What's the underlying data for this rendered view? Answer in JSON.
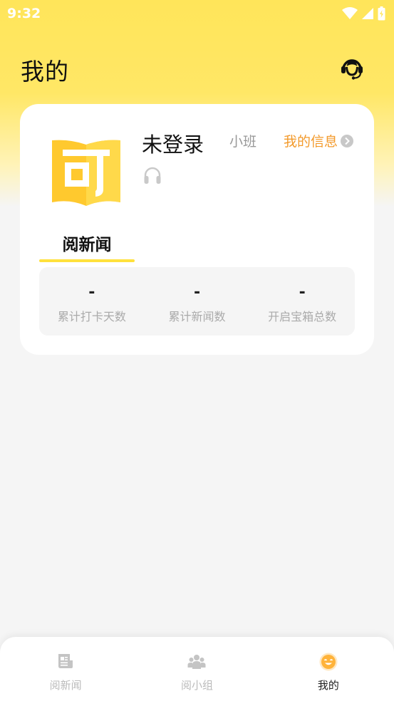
{
  "status_bar": {
    "time": "9:32"
  },
  "header": {
    "title": "我的",
    "support_icon": "headset-support-icon"
  },
  "profile": {
    "name": "未登录",
    "class_label": "小班",
    "my_info_label": "我的信息",
    "logo_char": "可",
    "headphone_icon": "headphone-icon"
  },
  "tabs": [
    {
      "label": "阅新闻",
      "active": true
    }
  ],
  "stats": [
    {
      "value": "-",
      "label": "累计打卡天数"
    },
    {
      "value": "-",
      "label": "累计新闻数"
    },
    {
      "value": "-",
      "label": "开启宝箱总数"
    }
  ],
  "bottom_nav": [
    {
      "label": "阅新闻",
      "icon": "news-icon",
      "active": false
    },
    {
      "label": "阅小组",
      "icon": "group-icon",
      "active": false
    },
    {
      "label": "我的",
      "icon": "smile-face-icon",
      "active": true
    }
  ],
  "colors": {
    "accent_yellow": "#ffe13c",
    "info_orange": "#f39a2b"
  }
}
